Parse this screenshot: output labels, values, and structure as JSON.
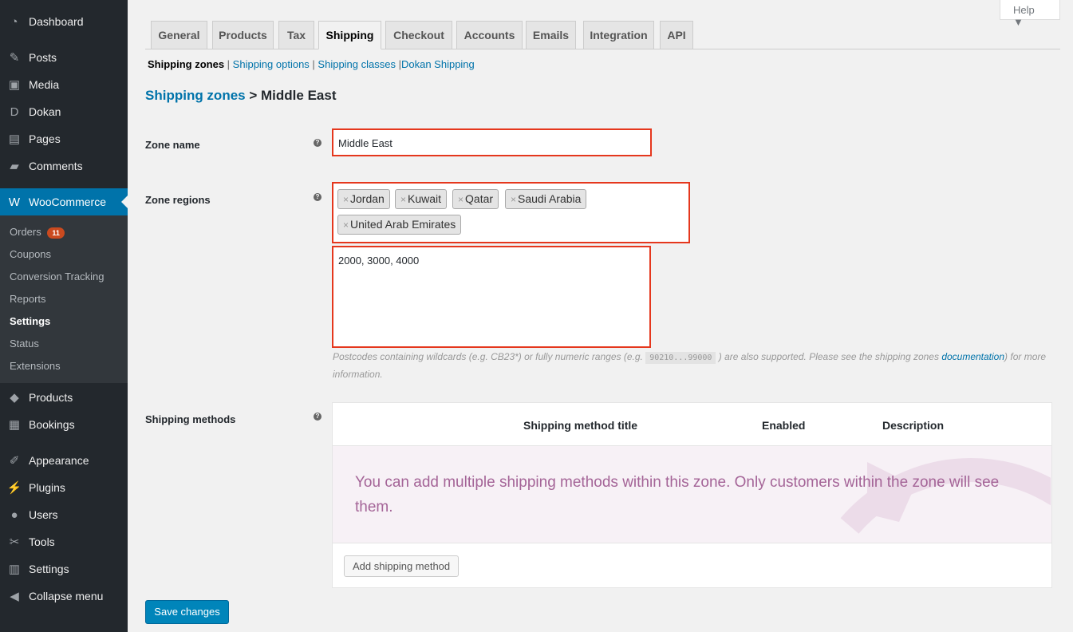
{
  "sidebar": {
    "items": [
      {
        "label": "Dashboard",
        "icon": "dashboard-icon",
        "glyph": "◔"
      },
      {
        "label": "Posts",
        "icon": "pin-icon",
        "glyph": "✎"
      },
      {
        "label": "Media",
        "icon": "media-icon",
        "glyph": "▣"
      },
      {
        "label": "Dokan",
        "icon": "dokan-icon",
        "glyph": "D"
      },
      {
        "label": "Pages",
        "icon": "pages-icon",
        "glyph": "▤"
      },
      {
        "label": "Comments",
        "icon": "comments-icon",
        "glyph": "▰"
      },
      {
        "label": "WooCommerce",
        "icon": "woo-icon",
        "glyph": "W"
      },
      {
        "label": "Products",
        "icon": "products-icon",
        "glyph": "◆"
      },
      {
        "label": "Bookings",
        "icon": "calendar-icon",
        "glyph": "▦"
      },
      {
        "label": "Appearance",
        "icon": "brush-icon",
        "glyph": "✐"
      },
      {
        "label": "Plugins",
        "icon": "plugin-icon",
        "glyph": "⚡"
      },
      {
        "label": "Users",
        "icon": "user-icon",
        "glyph": "●"
      },
      {
        "label": "Tools",
        "icon": "wrench-icon",
        "glyph": "✂"
      },
      {
        "label": "Settings",
        "icon": "settings-icon",
        "glyph": "▥"
      },
      {
        "label": "Collapse menu",
        "icon": "collapse-icon",
        "glyph": "◀"
      }
    ],
    "submenu": [
      {
        "label": "Orders",
        "badge": "11"
      },
      {
        "label": "Coupons"
      },
      {
        "label": "Conversion Tracking"
      },
      {
        "label": "Reports"
      },
      {
        "label": "Settings"
      },
      {
        "label": "Status"
      },
      {
        "label": "Extensions"
      }
    ]
  },
  "help": "Help ▼",
  "tabs": [
    "General",
    "Products",
    "Tax",
    "Shipping",
    "Checkout",
    "Accounts",
    "Emails",
    "Integration",
    "API"
  ],
  "subnav": {
    "current": "Shipping zones",
    "links": [
      "Shipping options",
      "Shipping classes",
      "Dokan Shipping"
    ]
  },
  "breadcrumb": {
    "link": "Shipping zones",
    "sep": ">",
    "current": "Middle East"
  },
  "form": {
    "zone_name_label": "Zone name",
    "zone_name": "Middle East",
    "zone_regions_label": "Zone regions",
    "regions": [
      "Jordan",
      "Kuwait",
      "Qatar",
      "Saudi Arabia",
      "United Arab Emirates"
    ],
    "postcodes": "2000, 3000, 4000",
    "hint1": "Postcodes containing wildcards (e.g. CB23*) or fully numeric ranges (e.g. ",
    "hint_code": "90210...99000",
    "hint2": " ) are also supported. Please see the shipping zones ",
    "hint_link": "documentation",
    "hint3": ") for more information.",
    "methods_label": "Shipping methods",
    "headers": [
      "Shipping method title",
      "Enabled",
      "Description"
    ],
    "blank": "You can add multiple shipping methods within this zone. Only customers within the zone will see them.",
    "add_button": "Add shipping method"
  },
  "save": "Save changes"
}
